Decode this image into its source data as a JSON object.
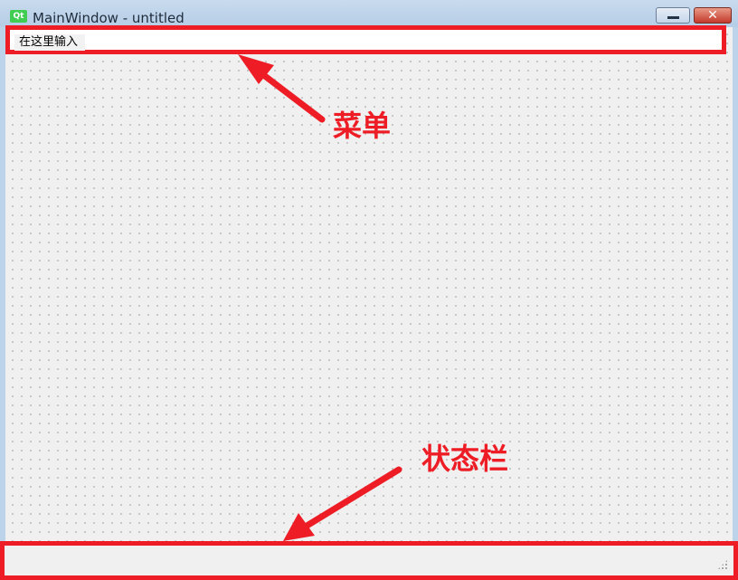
{
  "window": {
    "logo_text": "Qt",
    "title": "MainWindow - untitled",
    "minimize_symbol": "",
    "close_symbol": "✕"
  },
  "menubar": {
    "input_placeholder": "在这里输入"
  },
  "annotations": {
    "menu_label": "菜单",
    "status_label": "状态栏",
    "color": "#ee1c25"
  },
  "icons": {
    "logo": "qt-logo-icon",
    "minimize": "minimize-icon",
    "close": "close-icon",
    "grip": "size-grip-icon"
  }
}
